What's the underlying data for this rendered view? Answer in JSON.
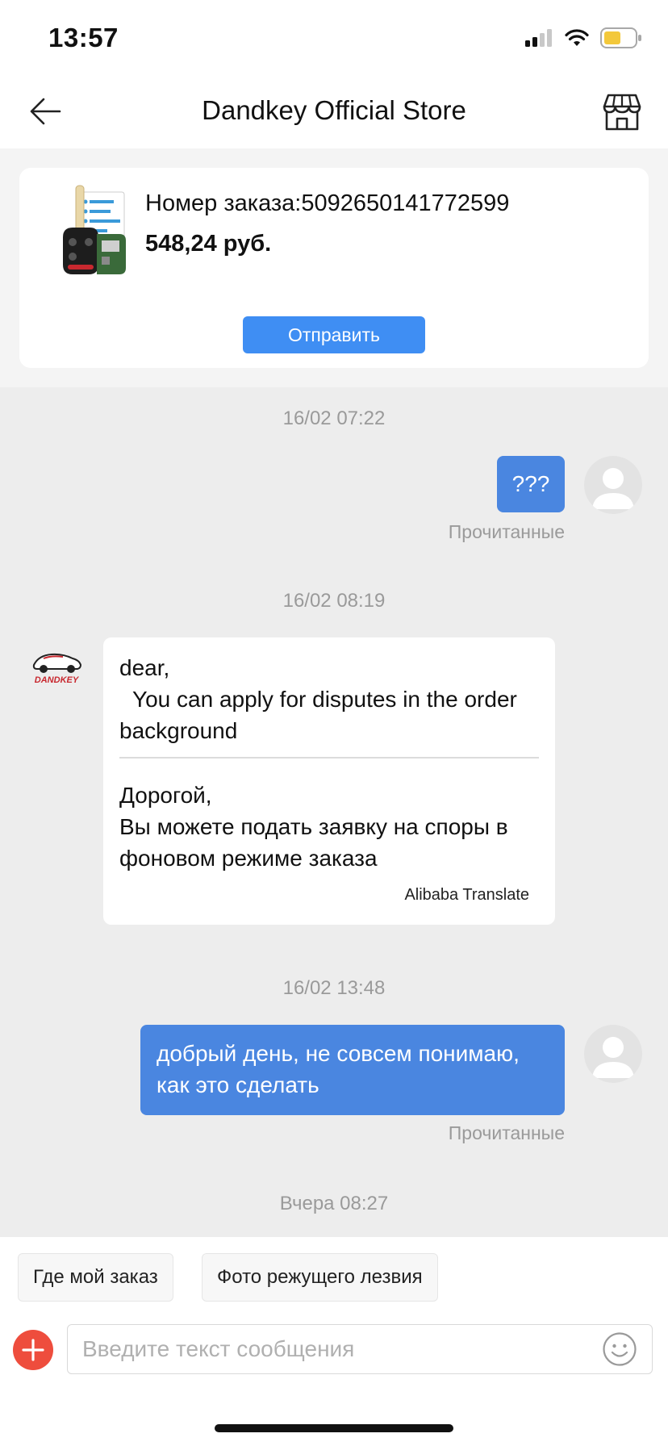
{
  "status_bar": {
    "time": "13:57"
  },
  "header": {
    "title": "Dandkey Official Store"
  },
  "order": {
    "number_text": "Номер заказа:5092650141772599",
    "price": "548,24 руб.",
    "send_label": "Отправить"
  },
  "messages": [
    {
      "timestamp": "16/02 07:22",
      "direction": "out",
      "text": "???",
      "status": "Прочитанные"
    },
    {
      "timestamp": "16/02 08:19",
      "direction": "in",
      "sender_logo_text": "DANDKEY",
      "original_line1": "dear,",
      "original_line2": "You can apply for disputes in the order background",
      "translated_line1": "Дорогой,",
      "translated_line2": "Вы можете подать заявку на споры в фоновом режиме заказа",
      "translation_credit": "Alibaba Translate"
    },
    {
      "timestamp": "16/02 13:48",
      "direction": "out",
      "text": "добрый день, не совсем понимаю, как это сделать",
      "status": "Прочитанные"
    },
    {
      "timestamp": "Вчера 08:27"
    }
  ],
  "quick_replies": [
    "Где мой заказ",
    "Фото режущего лезвия"
  ],
  "composer": {
    "placeholder": "Введите текст сообщения"
  },
  "colors": {
    "accent": "#4a86e0",
    "button": "#3f8ef3",
    "plus": "#ee4d3d",
    "battery": "#f3c83b"
  }
}
